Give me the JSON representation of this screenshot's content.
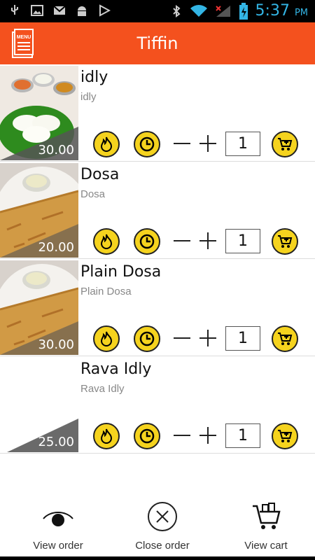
{
  "status_bar": {
    "time": "5:37",
    "ampm": "PM",
    "left_icons": [
      "usb-icon",
      "image-icon",
      "gmail-icon",
      "android-icon",
      "play-store-icon"
    ],
    "right_icons": [
      "bluetooth-icon",
      "wifi-icon",
      "signal-icon",
      "battery-icon"
    ],
    "accent_color": "#33b5e5"
  },
  "app_bar": {
    "title": "Tiffin",
    "menu_icon": "menu-card-icon",
    "color": "#f4511e"
  },
  "items": [
    {
      "name": "idly",
      "subtitle": "idly",
      "price": "30.00",
      "qty": "1"
    },
    {
      "name": "Dosa",
      "subtitle": "Dosa",
      "price": "20.00",
      "qty": "1"
    },
    {
      "name": "Plain Dosa",
      "subtitle": "Plain Dosa",
      "price": "30.00",
      "qty": "1"
    },
    {
      "name": "Rava Idly",
      "subtitle": "Rava Idly",
      "price": "25.00",
      "qty": "1"
    }
  ],
  "item_icons": [
    "spice-icon",
    "clock-icon",
    "minus-icon",
    "plus-icon",
    "add-to-cart-icon"
  ],
  "bottom_bar": {
    "view_order": "View order",
    "close_order": "Close order",
    "view_cart": "View cart"
  },
  "button_color": "#f5d31e"
}
